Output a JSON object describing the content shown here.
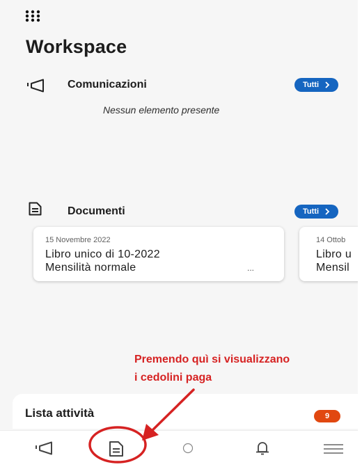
{
  "header": {
    "title": "Workspace",
    "menu_icon": "grid-icon"
  },
  "comunicazioni": {
    "icon": "megaphone-icon",
    "label": "Comunicazioni",
    "all_label": "Tutti",
    "empty_text": "Nessun elemento presente"
  },
  "documenti": {
    "icon": "document-icon",
    "label": "Documenti",
    "all_label": "Tutti",
    "cards": [
      {
        "date": "15 Novembre 2022",
        "line1": "Libro unico di 10-2022",
        "line2": "Mensilità normale",
        "more": "..."
      },
      {
        "date": "14 Ottob",
        "line1": "Libro u",
        "line2": "Mensil"
      }
    ]
  },
  "annotation": {
    "line1": "Premendo quì si visualizzano",
    "line2": "i cedolini paga",
    "color": "#d62222"
  },
  "tasks": {
    "label": "Lista attività",
    "count": "9"
  },
  "bottom_nav": {
    "items": [
      "megaphone-icon",
      "document-icon",
      "circle-icon",
      "bell-icon",
      "hamburger-icon"
    ]
  },
  "colors": {
    "accent": "#1565c0",
    "badge": "#e14810"
  }
}
